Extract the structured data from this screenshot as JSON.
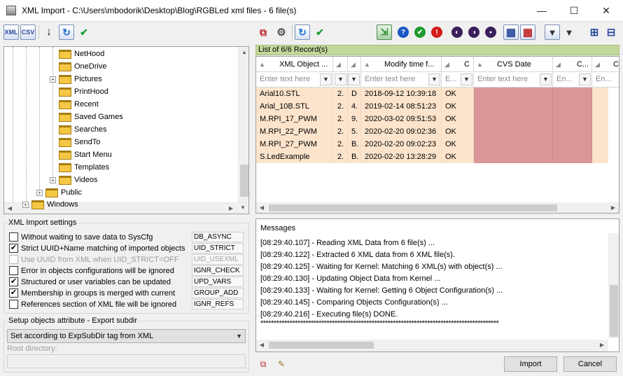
{
  "window": {
    "title": "XML Import - C:\\Users\\mbodorik\\Desktop\\Blog\\RGBLed xml files - 6 file(s)",
    "minimize_glyph": "—",
    "maximize_glyph": "☐",
    "close_glyph": "✕"
  },
  "left_toolbar": [
    {
      "name": "xml-icon",
      "label": "XML"
    },
    {
      "name": "csv-icon",
      "label": "CSV"
    },
    {
      "name": "arrow-down-icon",
      "label": "↓"
    },
    {
      "name": "refresh-icon",
      "label": "↻"
    },
    {
      "name": "checkmark-icon",
      "label": "✔"
    }
  ],
  "tree": {
    "items": [
      {
        "label": "NetHood",
        "level": 3,
        "expander": false
      },
      {
        "label": "OneDrive",
        "level": 3,
        "expander": false
      },
      {
        "label": "Pictures",
        "level": 3,
        "expander": true
      },
      {
        "label": "PrintHood",
        "level": 3,
        "expander": false
      },
      {
        "label": "Recent",
        "level": 3,
        "expander": false
      },
      {
        "label": "Saved Games",
        "level": 3,
        "expander": false
      },
      {
        "label": "Searches",
        "level": 3,
        "expander": false
      },
      {
        "label": "SendTo",
        "level": 3,
        "expander": false
      },
      {
        "label": "Start Menu",
        "level": 3,
        "expander": false
      },
      {
        "label": "Templates",
        "level": 3,
        "expander": false
      },
      {
        "label": "Videos",
        "level": 3,
        "expander": true
      },
      {
        "label": "Public",
        "level": 2,
        "expander": true
      },
      {
        "label": "Windows",
        "level": 1,
        "expander": true
      }
    ]
  },
  "settings": {
    "legend": "XML Import settings",
    "options": [
      {
        "label": "Without waiting to save data to SysCfg",
        "checked": false,
        "disabled": false,
        "tag": "DB_ASYNC"
      },
      {
        "label": "Strict UUID+Name matching of imported objects",
        "checked": true,
        "disabled": false,
        "tag": "UID_STRICT"
      },
      {
        "label": "Use UUID from XML when UID_STRICT=OFF",
        "checked": false,
        "disabled": true,
        "tag": "UID_USEXML"
      },
      {
        "label": "Error in objects configurations will be ignored",
        "checked": false,
        "disabled": false,
        "tag": "IGNR_CHECK"
      },
      {
        "label": "Structured or user variables can be updated",
        "checked": true,
        "disabled": false,
        "tag": "UPD_VARS"
      },
      {
        "label": "Membership in groups is merged with current",
        "checked": true,
        "disabled": false,
        "tag": "GROUP_ADD"
      },
      {
        "label": "References section of XML file will be ignored",
        "checked": false,
        "disabled": false,
        "tag": "IGNR_REFS"
      }
    ],
    "check_glyph": "✔"
  },
  "export": {
    "legend": "Setup objects attribute - Export subdir",
    "combo_value": "Set according to ExpSubDir tag from XML",
    "root_label": "Root directory:",
    "root_value": ""
  },
  "right_toolbar": [
    {
      "name": "copy-icon",
      "label": "⧉"
    },
    {
      "name": "gear-icon",
      "label": "⚙"
    },
    {
      "name": "refresh-icon",
      "label": "↻"
    },
    {
      "name": "checkmark-icon",
      "label": "✔"
    },
    {
      "name": "export-icon",
      "label": "⇲"
    },
    {
      "name": "help-icon",
      "label": "?"
    },
    {
      "name": "ok-circle-icon",
      "label": "✔"
    },
    {
      "name": "error-circle-icon",
      "label": "!"
    },
    {
      "name": "half-black-icon",
      "label": "◐"
    },
    {
      "name": "half-white-icon",
      "label": "◑"
    },
    {
      "name": "dot-black-icon",
      "label": "●"
    },
    {
      "name": "grid-blue-icon",
      "label": "▦"
    },
    {
      "name": "grid-red-icon",
      "label": "▦"
    },
    {
      "name": "filter-icon",
      "label": "▼"
    },
    {
      "name": "filter-add-icon",
      "label": "▼"
    },
    {
      "name": "expand-all-icon",
      "label": "⊞"
    },
    {
      "name": "collapse-all-icon",
      "label": "⊟"
    }
  ],
  "grid": {
    "caption": "List of 6/6 Record(s)",
    "filter_placeholder": "Enter text here",
    "filter_placeholder_short": "En...",
    "columns": [
      {
        "label": "XML Object ...",
        "width": 110,
        "placeholder": "Enter text here"
      },
      {
        "label": "",
        "width": 21,
        "placeholder": ""
      },
      {
        "label": "",
        "width": 19,
        "placeholder": ""
      },
      {
        "label": "Modify time f...",
        "width": 115,
        "placeholder": "Enter text here"
      },
      {
        "label": "C",
        "width": 40,
        "placeholder": "E..."
      },
      {
        "label": "CVS Date",
        "width": 113,
        "placeholder": "Enter text here"
      },
      {
        "label": "C...",
        "width": 56,
        "placeholder": "En..."
      },
      {
        "label": "C",
        "width": 40,
        "placeholder": "En..."
      }
    ],
    "rows": [
      {
        "name": "Arial10.STL",
        "c1": "2.",
        "c2": "D",
        "modified": "2018-09-12 10:39:18",
        "status": "OK"
      },
      {
        "name": "Arial_10B.STL",
        "c1": "2.",
        "c2": "4.",
        "modified": "2019-02-14 08:51:23",
        "status": "OK"
      },
      {
        "name": "M.RPI_17_PWM",
        "c1": "2.",
        "c2": "9.",
        "modified": "2020-03-02 09:51:53",
        "status": "OK"
      },
      {
        "name": "M.RPI_22_PWM",
        "c1": "2.",
        "c2": "5.",
        "modified": "2020-02-20 09:02:36",
        "status": "OK"
      },
      {
        "name": "M.RPI_27_PWM",
        "c1": "2.",
        "c2": "B.",
        "modified": "2020-02-20 09:02:23",
        "status": "OK"
      },
      {
        "name": "S.LedExample",
        "c1": "2.",
        "c2": "B.",
        "modified": "2020-02-20 13:28:29",
        "status": "OK"
      }
    ]
  },
  "messages": {
    "title": "Messages",
    "lines": [
      "[08:29:40.107] - Reading XML Data from 6 file(s) ...",
      "[08:29:40.122] - Extracted 6 XML data from 6 XML file(s).",
      "[08:29:40.125] - Waiting for Kernel: Matching 6 XML(s) with object(s) ...",
      "[08:29:40.130] - Updating Object Data from Kernel ...",
      "[08:29:40.133] - Waiting for Kernel: Getting 6 Object Configuration(s) ...",
      "[08:29:40.145] - Comparing Objects Configuration(s) ...",
      "[08:29:40.216] - Executing file(s) DONE.",
      "******************************************************************************************"
    ]
  },
  "buttons": {
    "import": "Import",
    "cancel": "Cancel"
  }
}
